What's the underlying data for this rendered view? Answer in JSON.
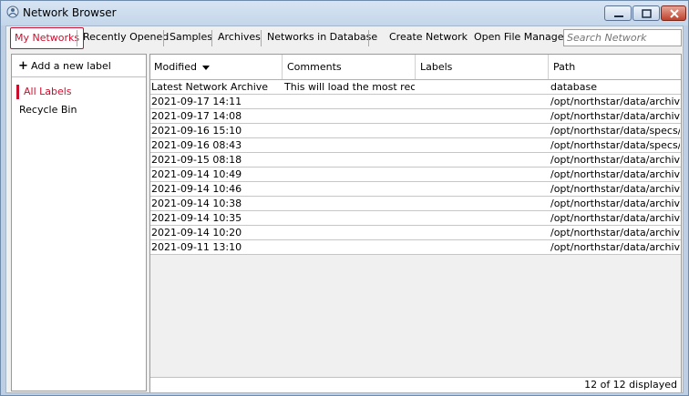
{
  "window": {
    "title": "Network Browser"
  },
  "toolbar": {
    "tabs": [
      {
        "label": "My Networks"
      },
      {
        "label": "Recently Opened"
      },
      {
        "label": "Samples"
      },
      {
        "label": "Archives"
      },
      {
        "label": "Networks in Database"
      }
    ],
    "create_network": "Create Network",
    "open_file_manager": "Open File Manager",
    "search_placeholder": "Search Network"
  },
  "sidebar": {
    "add_label": "Add a new label",
    "items": [
      {
        "label": "All Labels",
        "selected": true
      },
      {
        "label": "Recycle Bin",
        "selected": false
      }
    ]
  },
  "table": {
    "columns": [
      "Modified",
      "Comments",
      "Labels",
      "Path"
    ],
    "sort_column": "Modified",
    "rows": [
      {
        "modified": "Latest Network Archive",
        "comments": "This will load the most rece...",
        "labels": "",
        "path": "database"
      },
      {
        "modified": "2021-09-17 14:11",
        "comments": "",
        "labels": "",
        "path": "/opt/northstar/data/archiv..."
      },
      {
        "modified": "2021-09-17 14:08",
        "comments": "",
        "labels": "",
        "path": "/opt/northstar/data/archiv..."
      },
      {
        "modified": "2021-09-16 15:10",
        "comments": "",
        "labels": "",
        "path": "/opt/northstar/data/specs/..."
      },
      {
        "modified": "2021-09-16 08:43",
        "comments": "",
        "labels": "",
        "path": "/opt/northstar/data/specs/..."
      },
      {
        "modified": "2021-09-15 08:18",
        "comments": "",
        "labels": "",
        "path": "/opt/northstar/data/archiv..."
      },
      {
        "modified": "2021-09-14 10:49",
        "comments": "",
        "labels": "",
        "path": "/opt/northstar/data/archiv..."
      },
      {
        "modified": "2021-09-14 10:46",
        "comments": "",
        "labels": "",
        "path": "/opt/northstar/data/archiv..."
      },
      {
        "modified": "2021-09-14 10:38",
        "comments": "",
        "labels": "",
        "path": "/opt/northstar/data/archiv..."
      },
      {
        "modified": "2021-09-14 10:35",
        "comments": "",
        "labels": "",
        "path": "/opt/northstar/data/archiv..."
      },
      {
        "modified": "2021-09-14 10:20",
        "comments": "",
        "labels": "",
        "path": "/opt/northstar/data/archiv..."
      },
      {
        "modified": "2021-09-11 13:10",
        "comments": "",
        "labels": "",
        "path": "/opt/northstar/data/archiv..."
      }
    ],
    "status": "12 of 12 displayed"
  },
  "icons": {
    "app": "network-icon",
    "add": "plus-icon",
    "sort": "sort-down-icon"
  },
  "colors": {
    "accent": "#c8102e"
  }
}
